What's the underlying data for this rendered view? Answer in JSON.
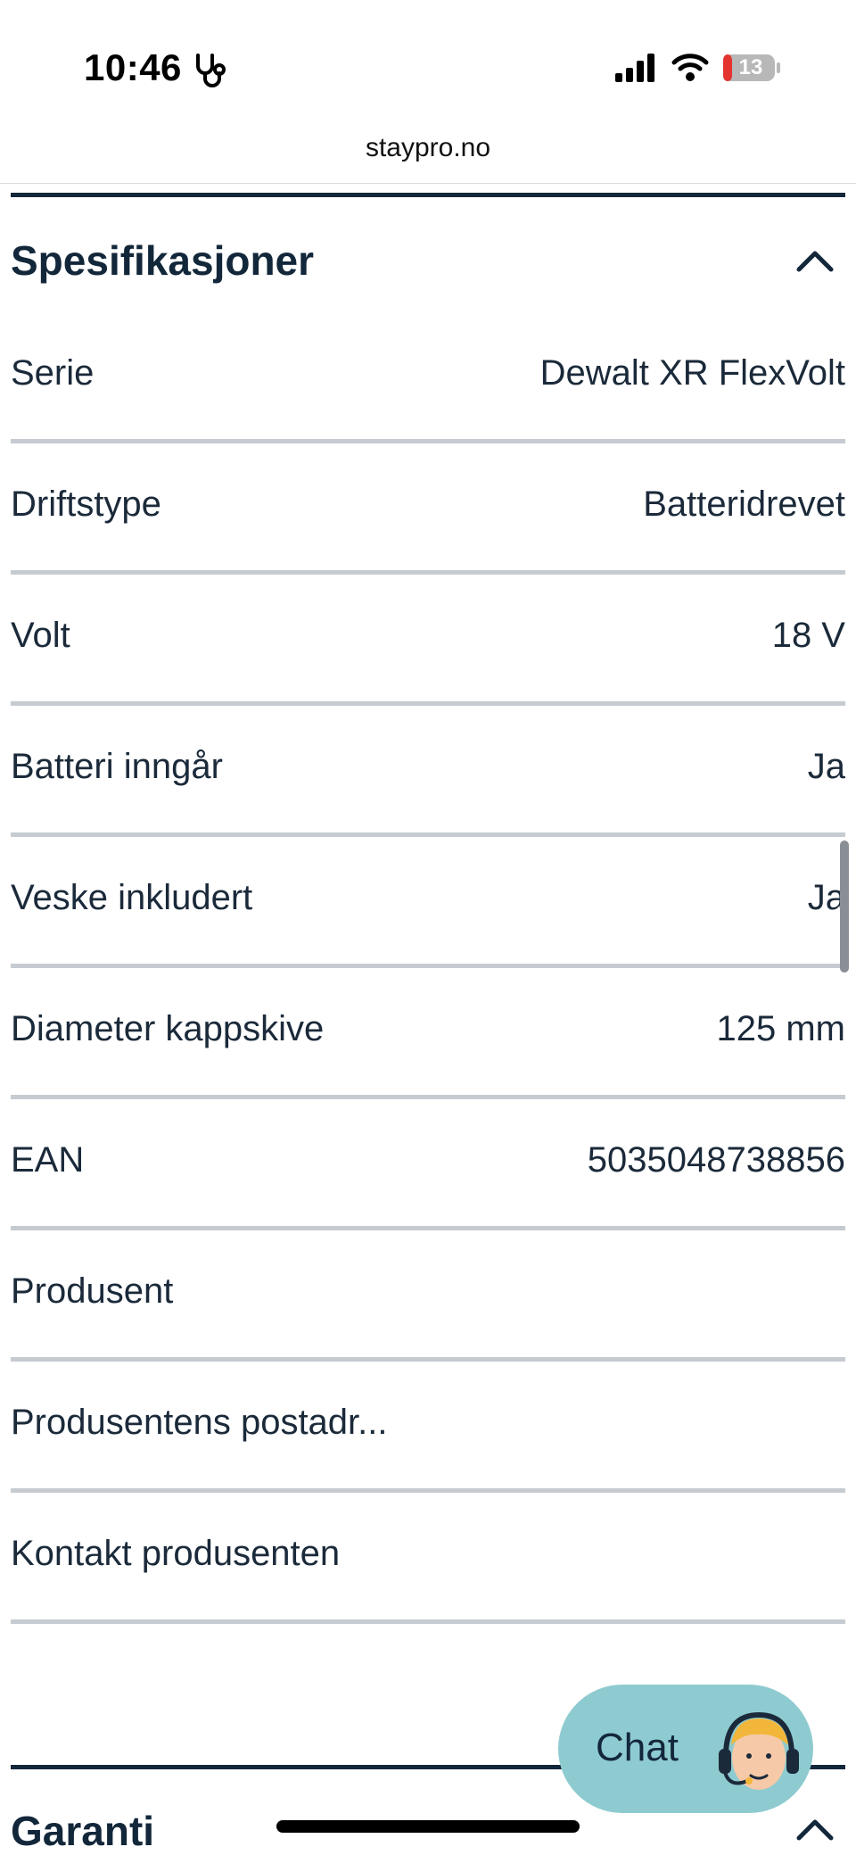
{
  "status_bar": {
    "time": "10:46",
    "battery_level": "13",
    "icons": [
      "stethoscope-icon",
      "signal-icon",
      "wifi-icon",
      "battery-icon"
    ]
  },
  "browser": {
    "url": "staypro.no"
  },
  "specs": {
    "title": "Spesifikasjoner",
    "expanded": true,
    "rows": [
      {
        "label": "Serie",
        "value": "Dewalt XR FlexVolt"
      },
      {
        "label": "Driftstype",
        "value": "Batteridrevet"
      },
      {
        "label": "Volt",
        "value": "18 V"
      },
      {
        "label": "Batteri inngår",
        "value": "Ja"
      },
      {
        "label": "Veske inkludert",
        "value": "Ja"
      },
      {
        "label": "Diameter kappskive",
        "value": "125 mm"
      },
      {
        "label": "EAN",
        "value": "5035048738856"
      },
      {
        "label": "Produsent",
        "value": ""
      },
      {
        "label": "Produsentens postadr...",
        "value": ""
      },
      {
        "label": "Kontakt produsenten",
        "value": ""
      }
    ]
  },
  "warranty": {
    "title": "Garanti",
    "expanded": true
  },
  "chat": {
    "label": "Chat"
  },
  "colors": {
    "text_dark": "#13273a",
    "divider": "#c6cbd1",
    "chat_bg": "#8ecbd0",
    "battery_red": "#e3342f"
  }
}
